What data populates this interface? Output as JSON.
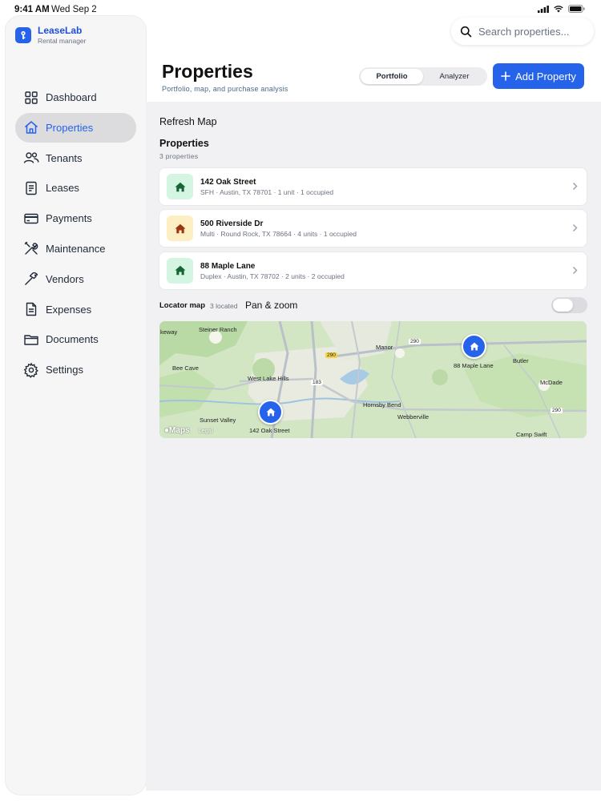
{
  "status_bar": {
    "time": "9:41 AM",
    "date": "Wed Sep 2"
  },
  "brand": {
    "name": "LeaseLab",
    "subtitle": "Rental manager",
    "accent": "#2563eb"
  },
  "sidebar": {
    "items": [
      {
        "label": "Dashboard",
        "icon": "dashboard-icon",
        "active": false
      },
      {
        "label": "Properties",
        "icon": "house-icon",
        "active": true
      },
      {
        "label": "Tenants",
        "icon": "people-icon",
        "active": false
      },
      {
        "label": "Leases",
        "icon": "document-icon",
        "active": false
      },
      {
        "label": "Payments",
        "icon": "credit-card-icon",
        "active": false
      },
      {
        "label": "Maintenance",
        "icon": "tools-icon",
        "active": false
      },
      {
        "label": "Vendors",
        "icon": "hammer-icon",
        "active": false
      },
      {
        "label": "Expenses",
        "icon": "receipt-icon",
        "active": false
      },
      {
        "label": "Documents",
        "icon": "folder-icon",
        "active": false
      },
      {
        "label": "Settings",
        "icon": "gear-icon",
        "active": false
      }
    ]
  },
  "search": {
    "placeholder": "Search properties..."
  },
  "header": {
    "title": "Properties",
    "subtitle": "Portfolio, map, and purchase analysis",
    "segments": [
      {
        "label": "Portfolio",
        "active": true
      },
      {
        "label": "Analyzer",
        "active": false
      }
    ],
    "add_button": "Add Property"
  },
  "content": {
    "refresh_label": "Refresh Map",
    "section_title": "Properties",
    "section_count": "3 properties",
    "properties": [
      {
        "name": "142 Oak Street",
        "detail": "SFH · Austin, TX 78701 · 1 unit · 1 occupied",
        "icon_bg": "#d5f5e3",
        "icon_color": "#166534"
      },
      {
        "name": "500 Riverside Dr",
        "detail": "Multi · Round Rock, TX 78664 · 4 units · 1 occupied",
        "icon_bg": "#fdefc3",
        "icon_color": "#9a3412"
      },
      {
        "name": "88 Maple Lane",
        "detail": "Duplex · Austin, TX 78702 · 2 units · 2 occupied",
        "icon_bg": "#d5f5e3",
        "icon_color": "#166534"
      }
    ],
    "locator": {
      "label": "Locator map",
      "count": "3 located",
      "pan_label": "Pan & zoom",
      "toggle_on": false
    },
    "map": {
      "brand": "Maps",
      "legal": "Legal",
      "places": [
        "keway",
        "Steiner Ranch",
        "Manor",
        "Bee Cave",
        "West Lake Hills",
        "Butler",
        "McDade",
        "Hornsby Bend",
        "Webberville",
        "Sunset Valley",
        "Camp Swift"
      ],
      "shields": [
        "290",
        "183",
        "290",
        "290"
      ],
      "pins": [
        "142 Oak Street",
        "88 Maple Lane"
      ]
    }
  }
}
